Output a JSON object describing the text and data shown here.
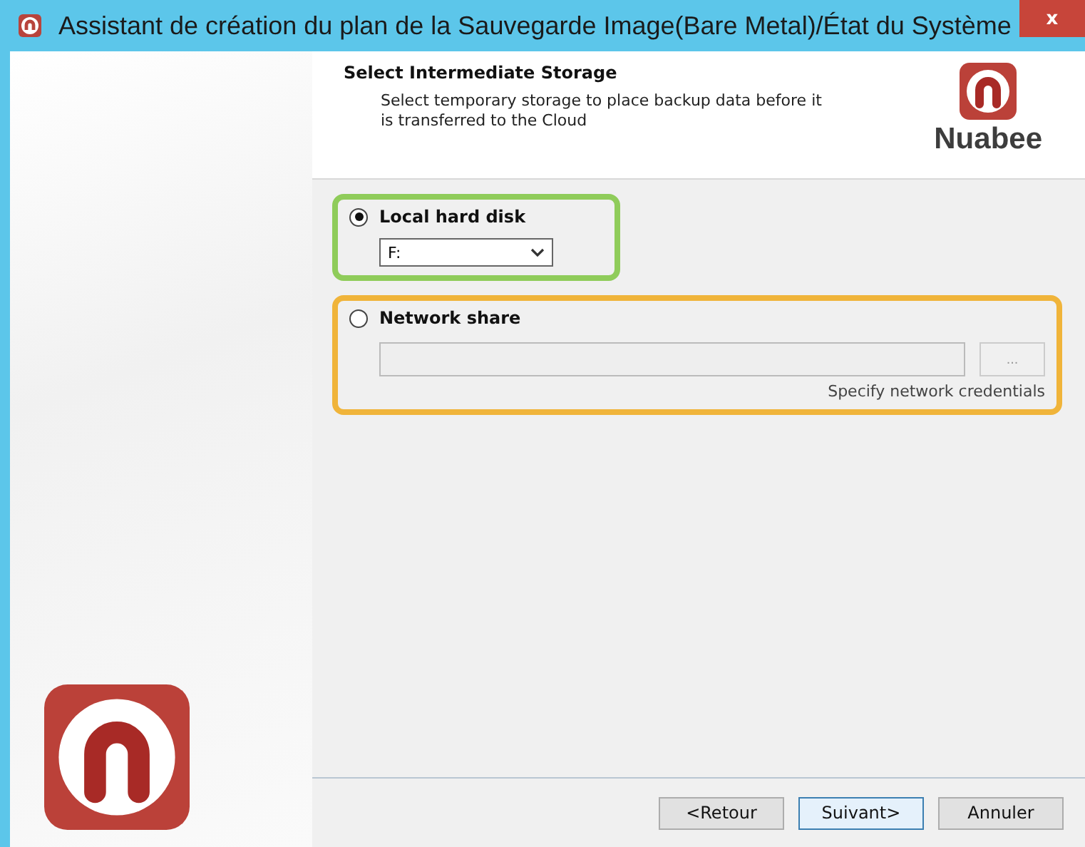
{
  "window": {
    "title": "Assistant de création du plan de la Sauvegarde Image(Bare Metal)/État du Système",
    "close": "x"
  },
  "header": {
    "title": "Select Intermediate Storage",
    "description": "Select temporary storage to place backup data before it is transferred to the Cloud",
    "brand": "Nuabee"
  },
  "options": [
    {
      "kind": "dropdown",
      "label": "Local hard disk",
      "selected": true,
      "value": "F:",
      "color": "#8fcc5a"
    },
    {
      "kind": "path",
      "label": "Network share",
      "selected": false,
      "browse": "...",
      "link": "Specify network credentials",
      "color": "#f0b43a"
    }
  ],
  "buttons": [
    {
      "label": "<Retour",
      "focused": false
    },
    {
      "label": "Suivant>",
      "focused": true
    },
    {
      "label": "Annuler",
      "focused": false
    }
  ]
}
